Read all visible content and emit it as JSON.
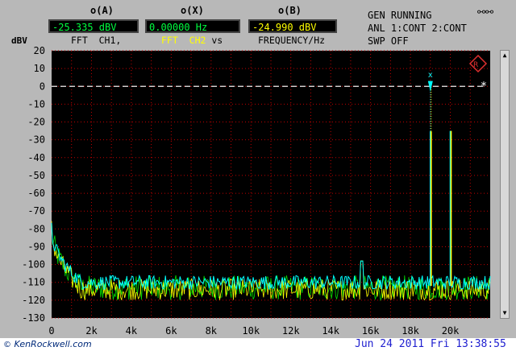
{
  "readouts": {
    "a_title": "o(A)",
    "x_title": "o(X)",
    "b_title": "o(B)",
    "a_value": "-25.335 dBV",
    "x_value": "0.00000 Hz",
    "b_value": "-24.990 dBV",
    "a_under": "FFT  CH1,",
    "x_under_fft": "FFT",
    "x_under_ch2": "CH2",
    "x_under_vs": "vs",
    "b_under": "FREQUENCY/Hz"
  },
  "status": {
    "line1": "GEN RUNNING",
    "line2": "ANL 1:CONT 2:CONT",
    "line3": "SWP OFF"
  },
  "footer": {
    "credit": "KenRockwell.com",
    "timestamp": "Jun 24 2011 Fri 13:38:55"
  },
  "colors": {
    "ch1": "#00ffff",
    "ch2": "#ffff00",
    "noise_green": "#00e000",
    "plot_bg": "#000000",
    "grid": "#c00000"
  },
  "chart_data": {
    "type": "line",
    "ylabel": "dBV",
    "xlim": [
      0,
      22000
    ],
    "ylim": [
      -130,
      20
    ],
    "x_tick_labels": [
      "0",
      "2k",
      "4k",
      "6k",
      "8k",
      "10k",
      "12k",
      "14k",
      "16k",
      "18k",
      "20k"
    ],
    "x_ticks": [
      0,
      2000,
      4000,
      6000,
      8000,
      10000,
      12000,
      14000,
      16000,
      18000,
      20000
    ],
    "y_ticks": [
      20,
      10,
      0,
      -10,
      -20,
      -30,
      -40,
      -50,
      -60,
      -70,
      -80,
      -90,
      -100,
      -110,
      -120,
      -130
    ],
    "reference_line_dbv": 0,
    "series": [
      {
        "color": "#00ffff",
        "noise_floor_dbv": -110,
        "peaks": [
          {
            "x": 19000,
            "y": -25.3
          },
          {
            "x": 20000,
            "y": -25.0
          }
        ]
      },
      {
        "color": "#ffff00",
        "noise_floor_dbv": -114,
        "peaks": [
          {
            "x": 19000,
            "y": -25.3
          },
          {
            "x": 20000,
            "y": -25.0
          }
        ]
      }
    ],
    "low_freq_rise": {
      "x": 0,
      "y": -80
    },
    "cursor_markers": [
      {
        "symbol": "x",
        "x": 19000,
        "y": -25.3
      },
      {
        "symbol": "*",
        "x": 22000,
        "y": 0
      }
    ],
    "grid": true
  }
}
